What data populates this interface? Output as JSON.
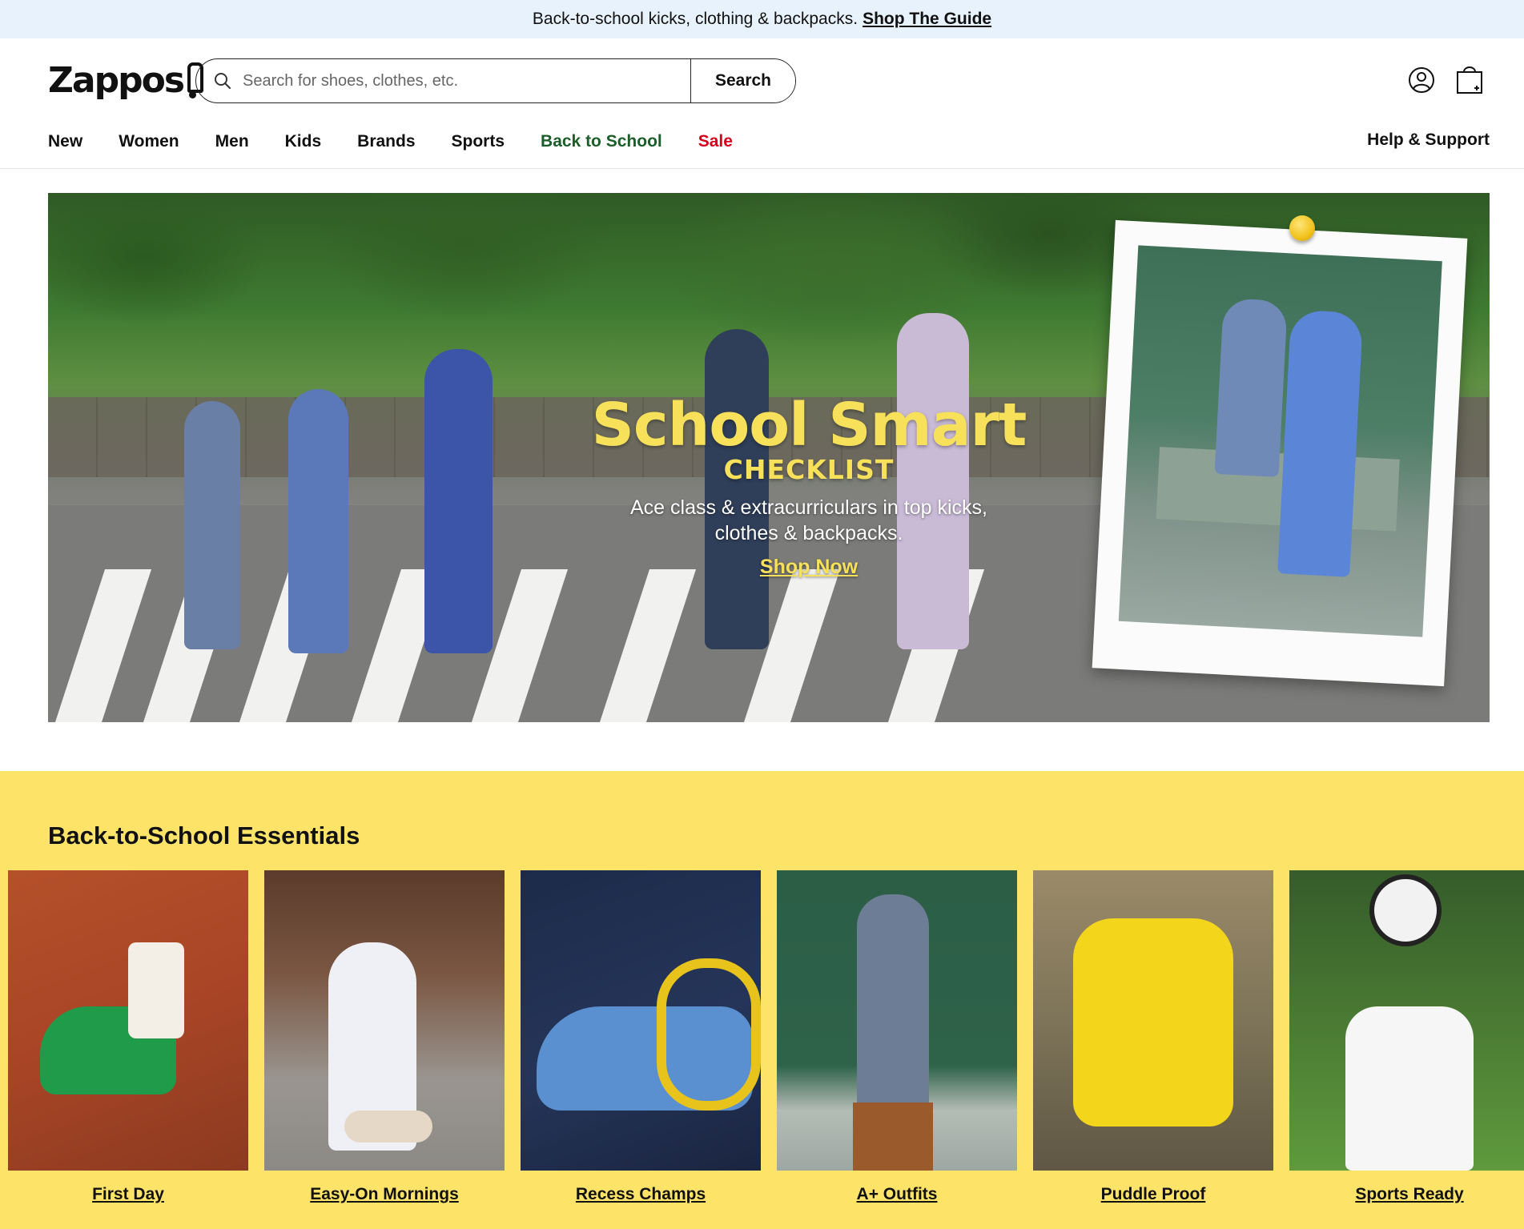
{
  "promo": {
    "text": "Back-to-school kicks, clothing & backpacks.",
    "link": "Shop The Guide"
  },
  "header": {
    "logo": "Zappos",
    "search": {
      "placeholder": "Search for shoes, clothes, etc.",
      "value": "",
      "button": "Search"
    },
    "icons": [
      "search-icon",
      "account-icon",
      "cart-icon"
    ]
  },
  "nav": {
    "items": [
      {
        "label": "New"
      },
      {
        "label": "Women"
      },
      {
        "label": "Men"
      },
      {
        "label": "Kids"
      },
      {
        "label": "Brands"
      },
      {
        "label": "Sports"
      },
      {
        "label": "Back to School",
        "color": "#1c5e2a"
      },
      {
        "label": "Sale",
        "color": "#d6001c"
      }
    ],
    "help": "Help & Support"
  },
  "hero": {
    "title": "School Smart",
    "subtitle": "CHECKLIST",
    "description_line1": "Ace class & extracurriculars in top kicks,",
    "description_line2": "clothes & backpacks.",
    "cta": "Shop Now",
    "accent_color": "#f7e05a"
  },
  "essentials": {
    "title": "Back-to-School Essentials",
    "background": "#fde469",
    "cards": [
      {
        "label": "First Day"
      },
      {
        "label": "Easy-On Mornings"
      },
      {
        "label": "Recess Champs"
      },
      {
        "label": "A+ Outfits"
      },
      {
        "label": "Puddle Proof"
      },
      {
        "label": "Sports Ready"
      }
    ]
  }
}
